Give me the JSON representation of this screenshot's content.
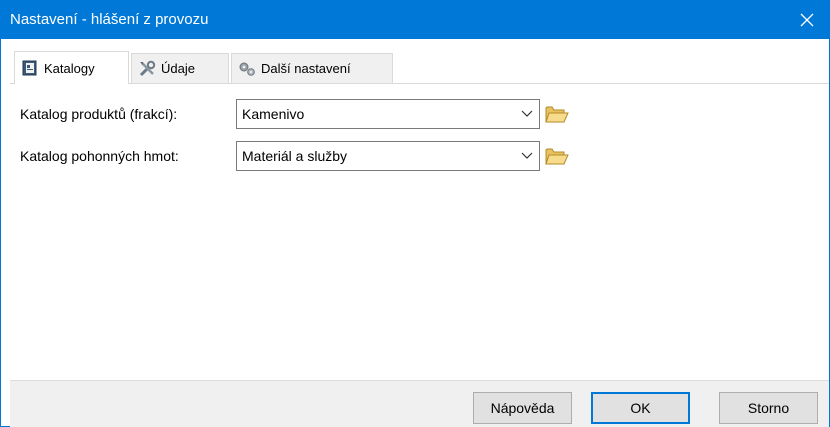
{
  "window": {
    "title": "Nastavení - hlášení z provozu",
    "close_icon": "close-icon",
    "accent": "#0078d7"
  },
  "tabs": [
    {
      "label": "Katalogy",
      "icon": "catalog-book-icon",
      "active": true
    },
    {
      "label": "Údaje",
      "icon": "tools-icon",
      "active": false
    },
    {
      "label": "Další nastavení",
      "icon": "gears-icon",
      "active": false
    }
  ],
  "form": {
    "rows": [
      {
        "label": "Katalog produktů (frakcí):",
        "value": "Kamenivo",
        "browse_icon": "folder-open-icon"
      },
      {
        "label": "Katalog pohonných hmot:",
        "value": "Materiál a služby",
        "browse_icon": "folder-open-icon"
      }
    ]
  },
  "footer": {
    "help_label": "Nápověda",
    "ok_label": "OK",
    "cancel_label": "Storno"
  }
}
